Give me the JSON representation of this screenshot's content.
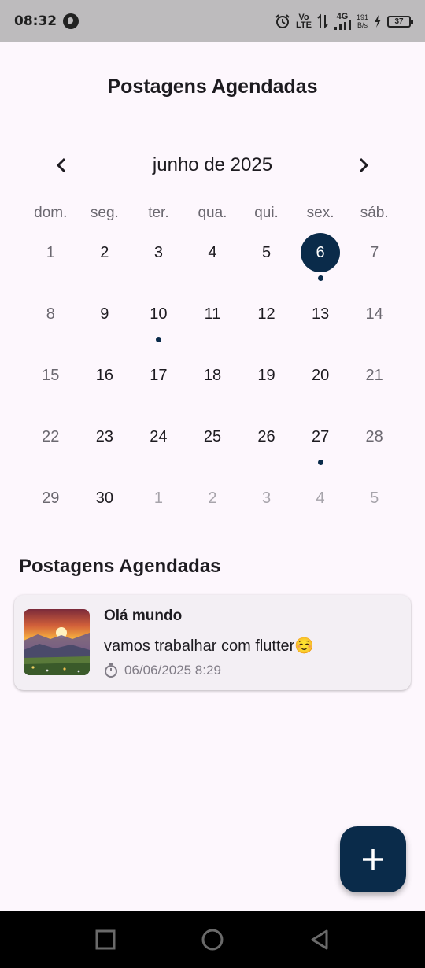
{
  "status_bar": {
    "time": "08:32",
    "network_top": "Vo",
    "network_bottom": "LTE",
    "signal_label": "4G",
    "speed_value": "191",
    "speed_unit": "B/s",
    "battery": "37"
  },
  "page": {
    "title": "Postagens Agendadas"
  },
  "calendar": {
    "month_label": "junho de 2025",
    "prev_icon": "chevron-left-icon",
    "next_icon": "chevron-right-icon",
    "weekdays": [
      "dom.",
      "seg.",
      "ter.",
      "qua.",
      "qui.",
      "sex.",
      "sáb."
    ],
    "selected_day": "6",
    "days": [
      "1",
      "2",
      "3",
      "4",
      "5",
      "6",
      "7",
      "8",
      "9",
      "10",
      "11",
      "12",
      "13",
      "14",
      "15",
      "16",
      "17",
      "18",
      "19",
      "20",
      "21",
      "22",
      "23",
      "24",
      "25",
      "26",
      "27",
      "28",
      "29",
      "30",
      "1",
      "2",
      "3",
      "4",
      "5"
    ],
    "days_with_posts": [
      "6",
      "10",
      "27"
    ]
  },
  "section": {
    "title": "Postagens Agendadas"
  },
  "posts": [
    {
      "title": "Olá mundo",
      "text": "vamos trabalhar com flutter☺️",
      "scheduled": "06/06/2025 8:29",
      "timer_icon": "timer-icon",
      "image": "sunset-landscape-thumbnail"
    }
  ],
  "fab": {
    "icon": "plus-icon"
  },
  "nav": {
    "icons": [
      "recents-square-icon",
      "home-circle-icon",
      "back-triangle-icon"
    ]
  },
  "colors": {
    "accent": "#0a2b4a",
    "background": "#fdf7fd",
    "card": "#f3eff4"
  }
}
